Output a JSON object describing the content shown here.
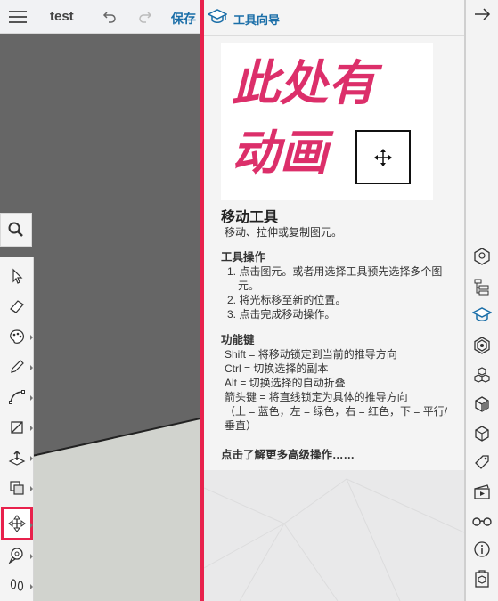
{
  "header": {
    "doc_title": "test",
    "save_label": "保存"
  },
  "instructor": {
    "panel_title": "工具向导",
    "animation_text_line1": "此处有",
    "animation_text_line2": "动画",
    "tool_name": "移动工具",
    "tool_description": "移动、拉伸或复制图元。",
    "operations_heading": "工具操作",
    "operations": [
      "1. 点击图元。或者用选择工具预先选择多个图元。",
      "2. 将光标移至新的位置。",
      "3. 点击完成移动操作。"
    ],
    "modifier_heading": "功能键",
    "modifier_keys": [
      "Shift = 将移动锁定到当前的推导方向",
      "Ctrl = 切换选择的副本",
      "Alt = 切换选择的自动折叠",
      "箭头键 = 将直线锁定为具体的推导方向",
      "（上 = 蓝色，左 = 绿色，右 = 红色，下 = 平行/垂直）"
    ],
    "more_link": "点击了解更多高级操作……"
  },
  "toolbar": {
    "tools": [
      "search-icon",
      "select-icon",
      "eraser-icon",
      "paint-icon",
      "pencil-icon",
      "arc-icon",
      "rectangle-icon",
      "push-pull-icon",
      "offset-icon",
      "move-icon",
      "tape-measure-icon",
      "walk-icon"
    ],
    "active_tool": "move-icon"
  },
  "tray": {
    "icons": [
      "entity-info-icon",
      "outliner-icon",
      "instructor-icon",
      "materials-icon",
      "components-icon",
      "styles-icon",
      "display-icon",
      "tags-icon",
      "scenes-icon",
      "views-icon",
      "info-icon",
      "3d-warehouse-icon"
    ],
    "active_icon": "instructor-icon"
  },
  "colors": {
    "accent_pink": "#e8214c",
    "link_blue": "#1a6ea8",
    "animation_text": "#dc2f6a",
    "canvas_gray": "#666666",
    "ground": "#d1d3ce"
  }
}
